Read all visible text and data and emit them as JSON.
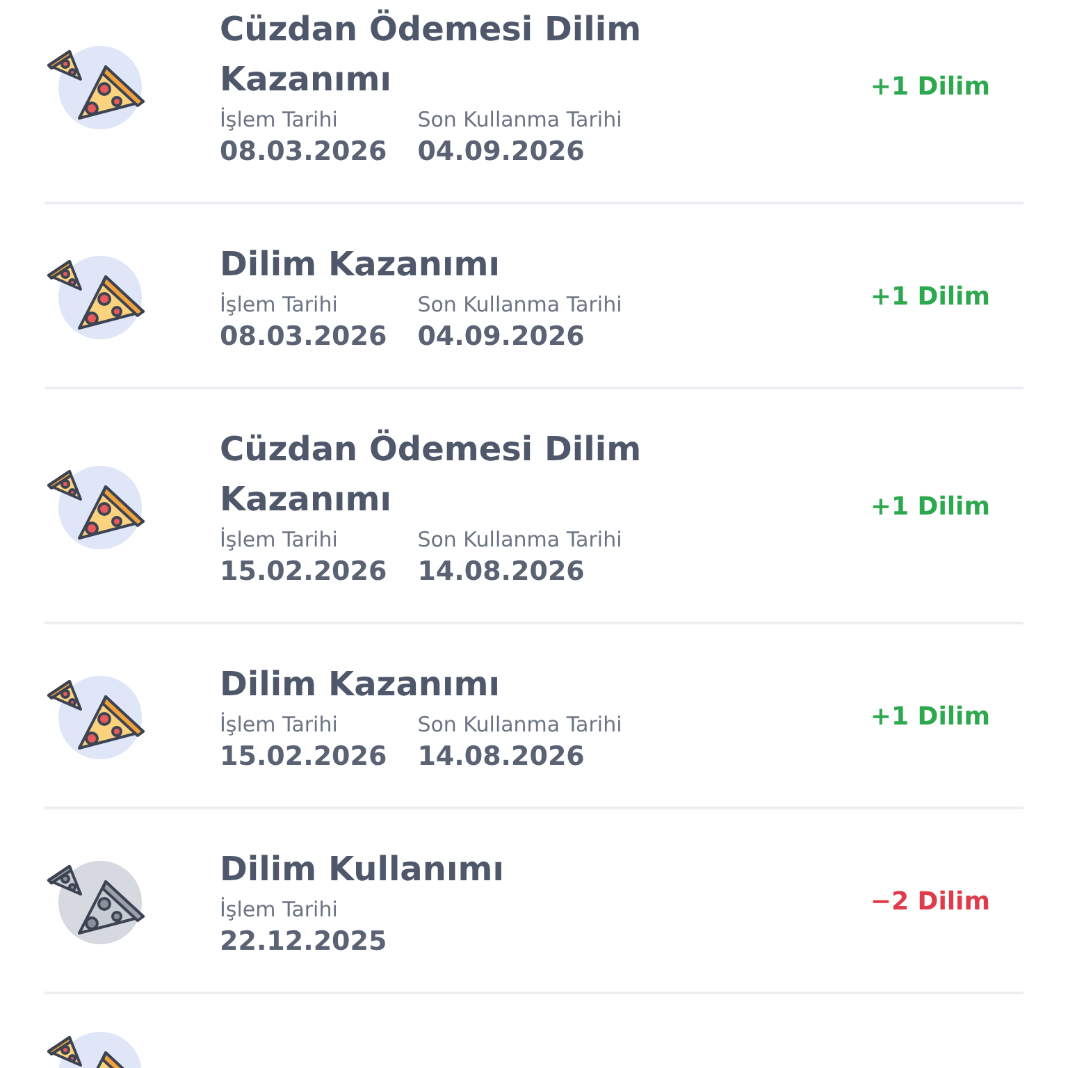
{
  "transactions": [
    {
      "kind": "earn",
      "title": "Cüzdan Ödemesi Dilim Kazanımı",
      "dates": [
        {
          "label": "İşlem Tarihi",
          "value": "08.03.2026"
        },
        {
          "label": "Son Kullanma Tarihi",
          "value": "04.09.2026"
        }
      ],
      "amount": "+1 Dilim"
    },
    {
      "kind": "earn",
      "title": "Dilim Kazanımı",
      "dates": [
        {
          "label": "İşlem Tarihi",
          "value": "08.03.2026"
        },
        {
          "label": "Son Kullanma Tarihi",
          "value": "04.09.2026"
        }
      ],
      "amount": "+1 Dilim"
    },
    {
      "kind": "earn",
      "title": "Cüzdan Ödemesi Dilim Kazanımı",
      "dates": [
        {
          "label": "İşlem Tarihi",
          "value": "15.02.2026"
        },
        {
          "label": "Son Kullanma Tarihi",
          "value": "14.08.2026"
        }
      ],
      "amount": "+1 Dilim"
    },
    {
      "kind": "earn",
      "title": "Dilim Kazanımı",
      "dates": [
        {
          "label": "İşlem Tarihi",
          "value": "15.02.2026"
        },
        {
          "label": "Son Kullanma Tarihi",
          "value": "14.08.2026"
        }
      ],
      "amount": "+1 Dilim"
    },
    {
      "kind": "use",
      "title": "Dilim Kullanımı",
      "dates": [
        {
          "label": "İşlem Tarihi",
          "value": "22.12.2025"
        }
      ],
      "amount": "−2 Dilim"
    },
    {
      "kind": "earn"
    }
  ]
}
